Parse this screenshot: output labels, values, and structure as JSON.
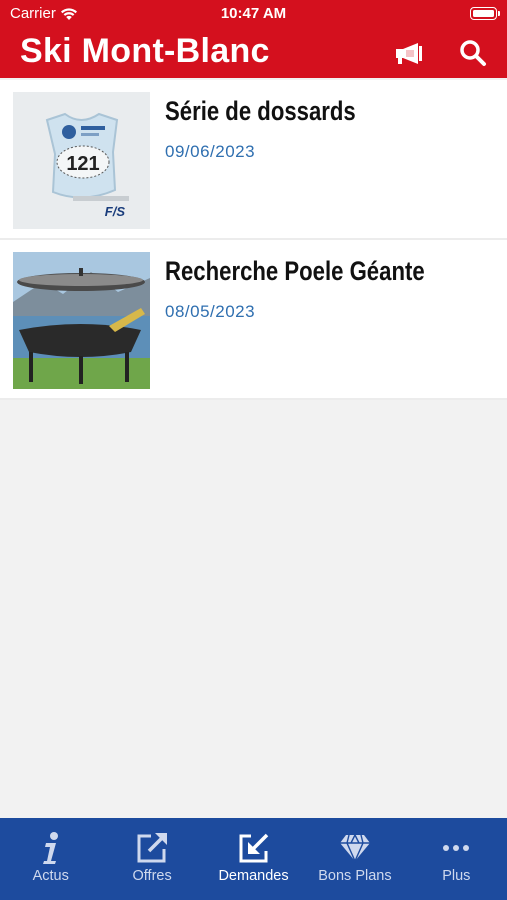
{
  "status_bar": {
    "carrier": "Carrier",
    "time": "10:47 AM"
  },
  "header": {
    "title": "Ski Mont-Blanc"
  },
  "list": {
    "items": [
      {
        "title": "Série de dossards",
        "date": "09/06/2023",
        "thumb_number": "121"
      },
      {
        "title": "Recherche Poele Géante",
        "date": "08/05/2023"
      }
    ]
  },
  "tabbar": {
    "tabs": [
      {
        "label": "Actus",
        "icon": "info-icon"
      },
      {
        "label": "Offres",
        "icon": "external-share-icon"
      },
      {
        "label": "Demandes",
        "icon": "inbox-arrow-icon"
      },
      {
        "label": "Bons Plans",
        "icon": "diamond-icon"
      },
      {
        "label": "Plus",
        "icon": "more-dots-icon"
      }
    ],
    "active": "Demandes"
  },
  "colors": {
    "header": "#d4101e",
    "tabbar": "#1d4b9e",
    "date": "#2f6fb0",
    "background": "#f2f2f2"
  }
}
